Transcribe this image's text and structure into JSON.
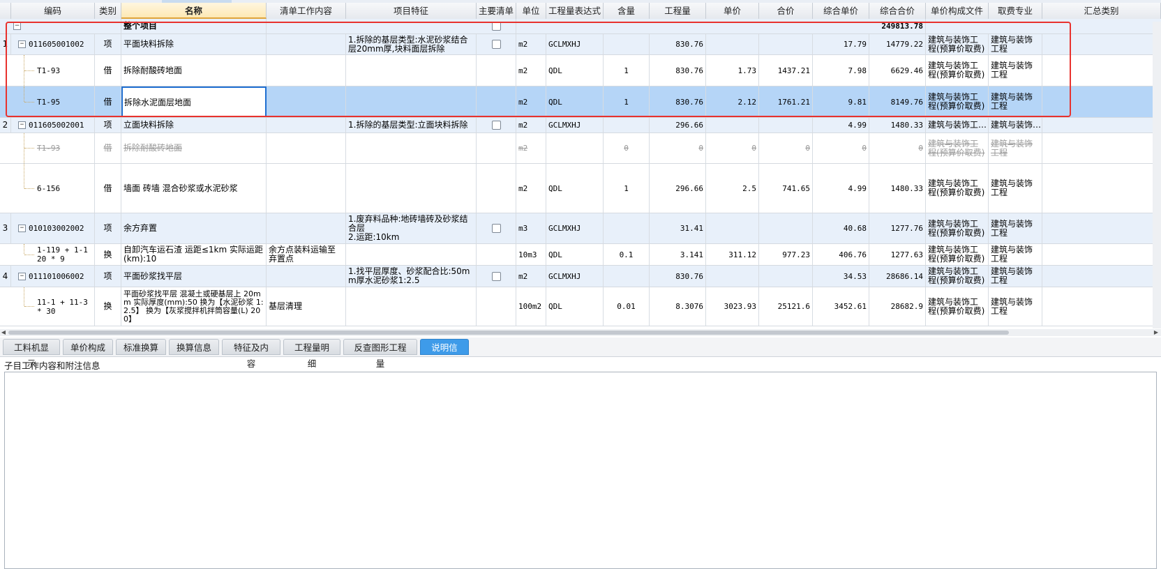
{
  "columns": {
    "code": "编码",
    "type": "类别",
    "name": "名称",
    "work": "清单工作内容",
    "feature": "项目特征",
    "main": "主要清单",
    "unit": "单位",
    "expr": "工程量表达式",
    "content": "含量",
    "qty": "工程量",
    "price": "单价",
    "total": "合价",
    "uprice": "综合单价",
    "utotal": "综合合价",
    "file": "单价构成文件",
    "major": "取费专业",
    "summary": "汇总类别"
  },
  "total_row": {
    "name": "整个项目",
    "utotal": "249813.78"
  },
  "rows": [
    {
      "idx": "1",
      "code": "011605001002",
      "type": "项",
      "name": "平面块料拆除",
      "feature": "1.拆除的基层类型:水泥砂浆结合层20mm厚,块料面层拆除",
      "unit": "m2",
      "expr": "GCLMXHJ",
      "qty": "830.76",
      "uprice": "17.79",
      "utotal": "14779.22",
      "file": "建筑与装饰工程(预算价取费)",
      "major": "建筑与装饰工程"
    },
    {
      "code": "T1-93",
      "type": "借",
      "name": "拆除耐酸砖地面",
      "unit": "m2",
      "expr": "QDL",
      "content": "1",
      "qty": "830.76",
      "price": "1.73",
      "total": "1437.21",
      "uprice": "7.98",
      "utotal": "6629.46",
      "file": "建筑与装饰工程(预算价取费)",
      "major": "建筑与装饰工程"
    },
    {
      "code": "T1-95",
      "type": "借",
      "name": "拆除水泥面层地面",
      "unit": "m2",
      "expr": "QDL",
      "content": "1",
      "qty": "830.76",
      "price": "2.12",
      "total": "1761.21",
      "uprice": "9.81",
      "utotal": "8149.76",
      "file": "建筑与装饰工程(预算价取费)",
      "major": "建筑与装饰工程"
    },
    {
      "idx": "2",
      "code": "011605002001",
      "type": "项",
      "name": "立面块料拆除",
      "feature": "1.拆除的基层类型:立面块料拆除",
      "unit": "m2",
      "expr": "GCLMXHJ",
      "qty": "296.66",
      "uprice": "4.99",
      "utotal": "1480.33",
      "file": "建筑与装饰工…",
      "major": "建筑与装饰…"
    },
    {
      "code": "T1-93",
      "type": "借",
      "name": "拆除耐酸砖地面",
      "unit": "m2",
      "content": "0",
      "qty": "0",
      "price": "0",
      "total": "0",
      "uprice": "0",
      "utotal": "0",
      "file": "建筑与装饰工程(预算价取费)",
      "major": "建筑与装饰工程"
    },
    {
      "code": "6-156",
      "type": "借",
      "name": "墙面 砖墙 混合砂浆或水泥砂浆",
      "unit": "m2",
      "expr": "QDL",
      "content": "1",
      "qty": "296.66",
      "price": "2.5",
      "total": "741.65",
      "uprice": "4.99",
      "utotal": "1480.33",
      "file": "建筑与装饰工程(预算价取费)",
      "major": "建筑与装饰工程"
    },
    {
      "idx": "3",
      "code": "010103002002",
      "type": "项",
      "name": "余方弃置",
      "feature": "1.废弃料品种:地砖墙砖及砂浆结合层\n2.运距:10km",
      "unit": "m3",
      "expr": "GCLMXHJ",
      "qty": "31.41",
      "uprice": "40.68",
      "utotal": "1277.76",
      "file": "建筑与装饰工程(预算价取费)",
      "major": "建筑与装饰工程"
    },
    {
      "code": "1-119 + 1-120 * 9",
      "type": "换",
      "name": "自卸汽车运石渣 运距≤1km  实际运距(km):10",
      "work": "余方点装料运输至弃置点",
      "unit": "10m3",
      "expr": "QDL",
      "content": "0.1",
      "qty": "3.141",
      "price": "311.12",
      "total": "977.23",
      "uprice": "406.76",
      "utotal": "1277.63",
      "file": "建筑与装饰工程(预算价取费)",
      "major": "建筑与装饰工程"
    },
    {
      "idx": "4",
      "code": "011101006002",
      "type": "项",
      "name": "平面砂浆找平层",
      "feature": "1.找平层厚度、砂浆配合比:50mm厚水泥砂浆1:2.5",
      "unit": "m2",
      "expr": "GCLMXHJ",
      "qty": "830.76",
      "uprice": "34.53",
      "utotal": "28686.14",
      "file": "建筑与装饰工程(预算价取费)",
      "major": "建筑与装饰工程"
    },
    {
      "code": "11-1 + 11-3 * 30",
      "type": "换",
      "name": "平面砂浆找平层 混凝土或硬基层上 20mm  实际厚度(mm):50  换为【水泥砂浆 1:2.5】  换为【灰浆搅拌机拌筒容量(L) 200】",
      "work": "基层清理",
      "unit": "100m2",
      "expr": "QDL",
      "content": "0.01",
      "qty": "8.3076",
      "price": "3023.93",
      "total": "25121.6",
      "uprice": "3452.61",
      "utotal": "28682.9",
      "file": "建筑与装饰工程(预算价取费)",
      "major": "建筑与装饰工程"
    }
  ],
  "tabs": [
    "工料机显示",
    "单价构成",
    "标准换算",
    "换算信息",
    "特征及内容",
    "工程量明细",
    "反查图形工程量",
    "说明信息"
  ],
  "info_label": "子目工作内容和附注信息"
}
